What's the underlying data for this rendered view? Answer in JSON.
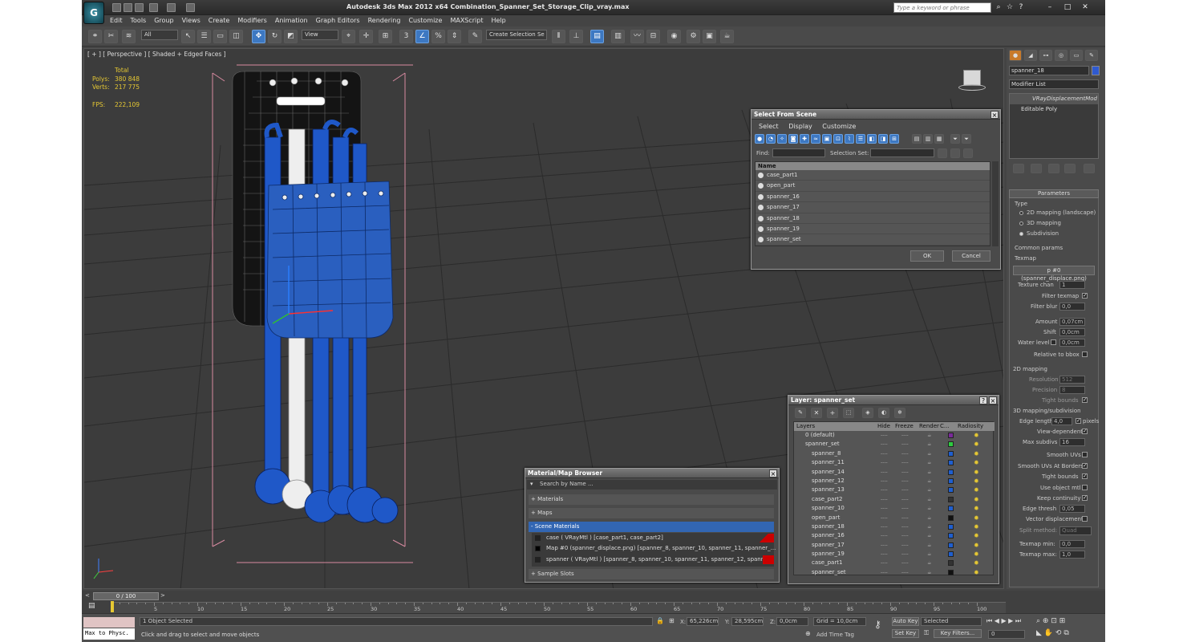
{
  "window": {
    "title": "Autodesk 3ds Max  2012 x64      Combination_Spanner_Set_Storage_Clip_vray.max",
    "search_placeholder": "Type a keyword or phrase"
  },
  "menu": [
    "Edit",
    "Tools",
    "Group",
    "Views",
    "Create",
    "Modifiers",
    "Animation",
    "Graph Editors",
    "Rendering",
    "Customize",
    "MAXScript",
    "Help"
  ],
  "toolbar": {
    "filter": "All",
    "refcoord": "View",
    "selection_set": "Create Selection Se"
  },
  "viewport": {
    "label": "[ + ] [ Perspective ] [ Shaded + Edged Faces ]",
    "stats": {
      "total_label": "Total",
      "polys_label": "Polys:",
      "polys": "380 848",
      "verts_label": "Verts:",
      "verts": "217 775",
      "fps_label": "FPS:",
      "fps": "222,109"
    }
  },
  "select_from_scene": {
    "title": "Select From Scene",
    "menus": [
      "Select",
      "Display",
      "Customize"
    ],
    "find_label": "Find:",
    "selset_label": "Selection Set:",
    "column": "Name",
    "items": [
      "case_part1",
      "open_part",
      "spanner_16",
      "spanner_17",
      "spanner_18",
      "spanner_19",
      "spanner_set"
    ],
    "ok": "OK",
    "cancel": "Cancel"
  },
  "layer_dialog": {
    "title": "Layer: spanner_set",
    "headers": [
      "Layers",
      "Hide",
      "Freeze",
      "Render",
      "C...",
      "Radiosity"
    ],
    "rows": [
      {
        "name": "0 (default)",
        "level": 0,
        "color": "#7a2a9a"
      },
      {
        "name": "spanner_set",
        "level": 0,
        "color": "#2ecc40"
      },
      {
        "name": "spanner_8",
        "level": 1,
        "color": "#1f5fd0"
      },
      {
        "name": "spanner_11",
        "level": 1,
        "color": "#1f5fd0"
      },
      {
        "name": "spanner_14",
        "level": 1,
        "color": "#1f5fd0"
      },
      {
        "name": "spanner_12",
        "level": 1,
        "color": "#1f5fd0"
      },
      {
        "name": "spanner_13",
        "level": 1,
        "color": "#1f5fd0"
      },
      {
        "name": "case_part2",
        "level": 1,
        "color": "#333333"
      },
      {
        "name": "spanner_10",
        "level": 1,
        "color": "#1f5fd0"
      },
      {
        "name": "open_part",
        "level": 1,
        "color": "#111111"
      },
      {
        "name": "spanner_18",
        "level": 1,
        "color": "#1f5fd0"
      },
      {
        "name": "spanner_16",
        "level": 1,
        "color": "#1f5fd0"
      },
      {
        "name": "spanner_17",
        "level": 1,
        "color": "#1f5fd0"
      },
      {
        "name": "spanner_19",
        "level": 1,
        "color": "#1f5fd0"
      },
      {
        "name": "case_part1",
        "level": 1,
        "color": "#333333"
      },
      {
        "name": "spanner_set",
        "level": 1,
        "color": "#111111"
      }
    ]
  },
  "material_browser": {
    "title": "Material/Map Browser",
    "search": "Search by Name ...",
    "groups": [
      "+ Materials",
      "+ Maps",
      "- Scene Materials",
      "+ Sample Slots"
    ],
    "items": [
      "case  ( VRayMtl ) [case_part1, case_part2]",
      "Map #0 (spanner_displace.png) [spanner_8, spanner_10, spanner_11, spanner_...",
      "spanner  ( VRayMtl ) [spanner_8, spanner_10, spanner_11, spanner_12, spanne..."
    ]
  },
  "command_panel": {
    "object_name": "spanner_18",
    "modifier_list": "Modifier List",
    "stack": [
      "VRayDisplacementMod",
      "Editable Poly"
    ],
    "parameters_title": "Parameters",
    "type_label": "Type",
    "types": [
      "2D mapping (landscape)",
      "3D mapping",
      "Subdivision"
    ],
    "common_params": "Common params",
    "texmap_label": "Texmap",
    "texmap": "p #0 (spanner_displace.png)",
    "texture_chan_label": "Texture chan",
    "texture_chan": "1",
    "filter_texmap": "Filter texmap",
    "filter_blur_label": "Filter blur",
    "filter_blur": "0,0",
    "amount_label": "Amount",
    "amount": "0,07cm",
    "shift_label": "Shift",
    "shift": "0,0cm",
    "water_label": "Water level",
    "water": "0,0cm",
    "relative_bbox": "Relative to bbox",
    "mapping2d": "2D mapping",
    "resolution_label": "Resolution",
    "resolution": "512",
    "precision_label": "Precision",
    "precision": "8",
    "tight_bounds": "Tight bounds",
    "mapping3d": "3D mapping/subdivision",
    "edge_length_label": "Edge length",
    "edge_length": "4,0",
    "pixels": "pixels",
    "view_dependent": "View-dependent",
    "max_subdivs_label": "Max subdivs",
    "max_subdivs": "16",
    "smooth_uvs": "Smooth UVs",
    "smooth_uvs_borders": "Smooth UVs At Borders",
    "tight_bounds2": "Tight bounds",
    "use_object_mtl": "Use object mtl",
    "keep_continuity": "Keep continuity",
    "edge_thresh_label": "Edge thresh",
    "edge_thresh": "0,05",
    "vector_disp": "Vector displacement",
    "split_method_label": "Split method:",
    "split_method": "Quad",
    "texmap_min_label": "Texmap min:",
    "texmap_min": "0,0",
    "texmap_max_label": "Texmap max:",
    "texmap_max": "1,0"
  },
  "timeline": {
    "frame": "0 / 100",
    "ticks": [
      "0",
      "5",
      "10",
      "15",
      "20",
      "25",
      "30",
      "35",
      "40",
      "45",
      "50",
      "55",
      "60",
      "65",
      "70",
      "75",
      "80",
      "85",
      "90",
      "95",
      "100"
    ],
    "progress": 0
  },
  "status": {
    "listener": "Max to Physc.",
    "selected": "1 Object Selected",
    "prompt": "Click and drag to select and move objects",
    "x_label": "X:",
    "x": "65,226cm",
    "y_label": "Y:",
    "y": "28,595cm",
    "z_label": "Z:",
    "z": "0,0cm",
    "grid": "Grid = 10,0cm",
    "add_time_tag": "Add Time Tag",
    "auto_key": "Auto Key",
    "set_key": "Set Key",
    "key_mode": "Selected",
    "key_filters": "Key Filters...",
    "frame": "0"
  }
}
